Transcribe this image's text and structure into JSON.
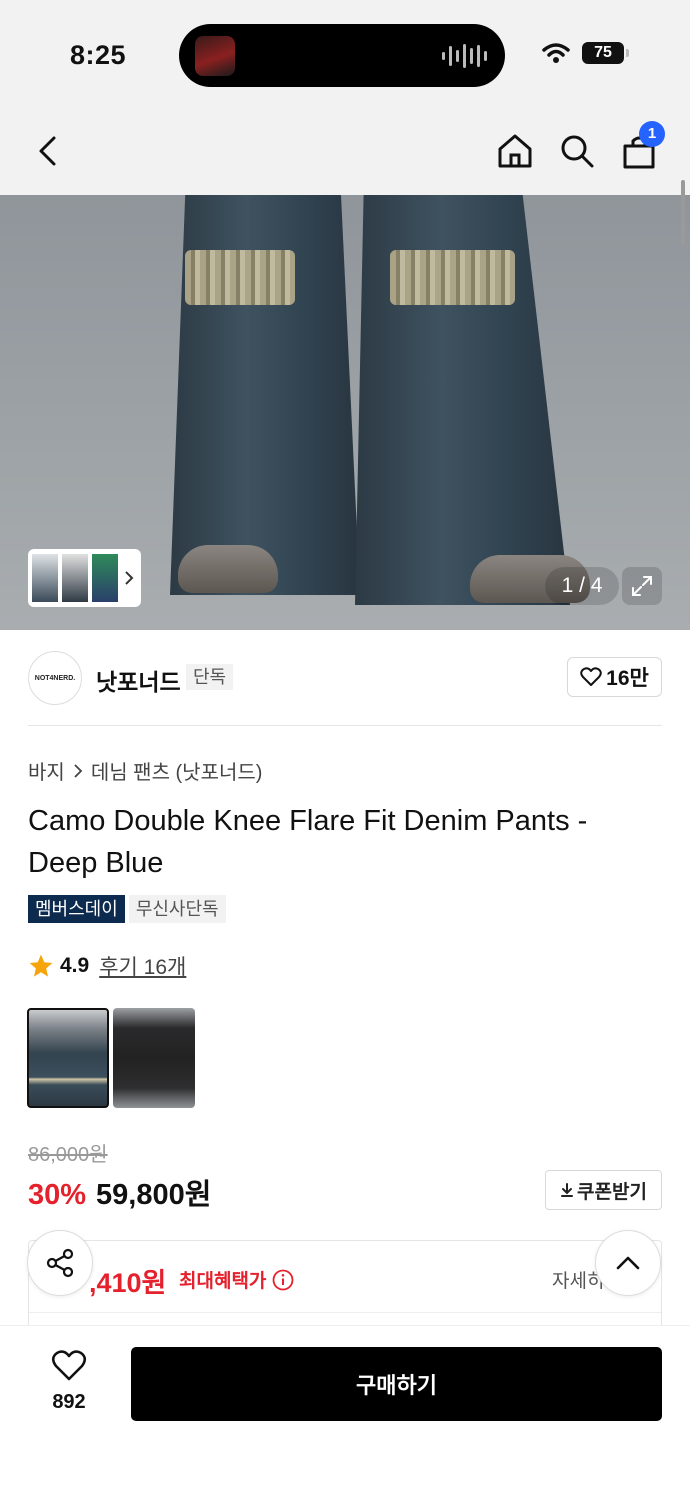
{
  "status_bar": {
    "time": "8:25",
    "battery": "75"
  },
  "header": {
    "cart_count": "1",
    "icons": [
      "back-icon",
      "home-icon",
      "search-icon",
      "cart-icon"
    ]
  },
  "gallery": {
    "counter": "1 / 4"
  },
  "brand": {
    "logo_text": "NOT4NERD.",
    "name": "낫포너드",
    "tag": "단독",
    "likes": "16만"
  },
  "breadcrumb": {
    "category": "바지",
    "subcategory": "데님 팬츠 (낫포너드)"
  },
  "product": {
    "title": "Camo Double Knee Flare Fit Denim Pants - Deep Blue",
    "tags": [
      "멤버스데이",
      "무신사단독"
    ],
    "rating": "4.9",
    "reviews": "후기 16개"
  },
  "price": {
    "original": "86,000원",
    "discount": "30%",
    "sale": "59,800원",
    "coupon_label": "쿠폰받기"
  },
  "benefit": {
    "price": ",410원",
    "label": "최대혜택가",
    "detail": "자세히"
  },
  "bottom": {
    "like_count": "892",
    "buy_label": "구매하기"
  },
  "colors": {
    "accent_red": "#e4212c",
    "member_tag": "#0d2b4e",
    "badge_blue": "#2563ff"
  }
}
